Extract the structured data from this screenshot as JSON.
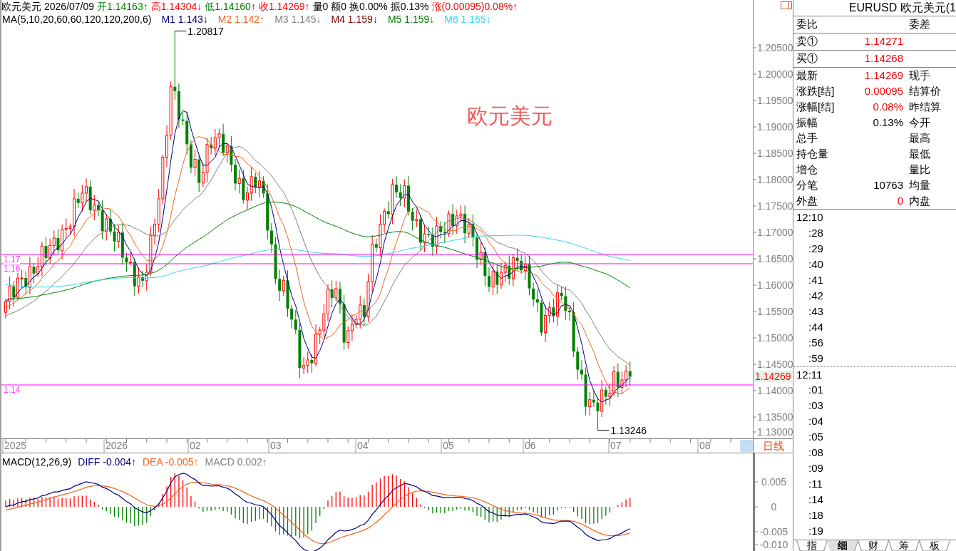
{
  "chart_header": {
    "quote_items": [
      {
        "text": "欧元美元",
        "color": "#000000"
      },
      {
        "text": "2026/07/09",
        "color": "#000000"
      },
      {
        "text": "开1.14163↑",
        "color": "#008000"
      },
      {
        "text": "高1.14304↓",
        "color": "#ff0000"
      },
      {
        "text": "低1.14160↑",
        "color": "#008000"
      },
      {
        "text": "收1.14269↑",
        "color": "#ff0000"
      },
      {
        "text": "量0",
        "color": "#000000"
      },
      {
        "text": "额0",
        "color": "#000000"
      },
      {
        "text": "换0.00%",
        "color": "#000000"
      },
      {
        "text": "振0.13%",
        "color": "#000000"
      },
      {
        "text": "涨(0.00095)0.08%↑",
        "color": "#ff0000"
      }
    ],
    "ma_legend": [
      {
        "text": "MA(5,10,20,60,60,120,120,200,6)",
        "color": "#000000"
      },
      {
        "text": "M1 1.143↓",
        "color": "#000080"
      },
      {
        "text": "M2 1.142↑",
        "color": "#f26522"
      },
      {
        "text": "M3 1.145↓",
        "color": "#808080"
      },
      {
        "text": "M4 1.159↓",
        "color": "#800000"
      },
      {
        "text": "M5 1.159↓",
        "color": "#008000"
      },
      {
        "text": "M6 1.165↓",
        "color": "#33d6f0"
      }
    ]
  },
  "price_chart": {
    "symbol_label": "欧元美元",
    "high_marker": "1.20817",
    "low_marker": "1.13246",
    "drawn_lines": [
      {
        "label": "1.17"
      },
      {
        "label": "1.16"
      },
      {
        "label": "1.14"
      }
    ],
    "price_axis": [
      "1.20500",
      "1.20000",
      "1.19500",
      "1.19000",
      "1.18500",
      "1.18000",
      "1.17500",
      "1.17000",
      "1.16500",
      "1.16000",
      "1.15500",
      "1.15000",
      "1.14500",
      "1.14000",
      "1.13500",
      "1.13000"
    ],
    "current_price": "1.14269",
    "time_axis": [
      "2025",
      "2026",
      "02",
      "03",
      "04",
      "05",
      "06",
      "07",
      "08"
    ],
    "period": "日线"
  },
  "macd": {
    "legend": [
      {
        "text": "MACD(12,26,9)",
        "color": "#000000"
      },
      {
        "text": "DIFF -0.004↑",
        "color": "#000080"
      },
      {
        "text": "DEA -0.005↑",
        "color": "#f26522"
      },
      {
        "text": "MACD 0.002↑",
        "color": "#808080"
      }
    ],
    "axis": [
      "0.005",
      "0",
      "-0.005",
      "-0.010"
    ]
  },
  "quote_panel": {
    "title": "EURUSD 欧元美元(1",
    "order_ratio": {
      "label": "委比",
      "right_label": "委差"
    },
    "order_book": [
      {
        "label": "卖①",
        "price": "1.14271",
        "color": "#ff0000"
      },
      {
        "label": "买①",
        "price": "1.14268",
        "color": "#ff0000"
      }
    ],
    "stats": [
      {
        "label": "最新",
        "value": "1.14269",
        "color": "#ff0000",
        "right_label": "现手"
      },
      {
        "label": "涨跌[结]",
        "value": "0.00095",
        "color": "#ff0000",
        "right_label": "结算价"
      },
      {
        "label": "涨幅[结]",
        "value": "0.08%",
        "color": "#ff0000",
        "right_label": "昨结算"
      },
      {
        "label": "振幅",
        "value": "0.13%",
        "color": "#000000",
        "right_label": "今开"
      },
      {
        "label": "总手",
        "right_label": "最高"
      },
      {
        "label": "持仓量",
        "right_label": "最低"
      },
      {
        "label": "增仓",
        "right_label": "量比"
      },
      {
        "label": "分笔",
        "value": "10763",
        "color": "#000000",
        "right_label": "均量"
      },
      {
        "label": "外盘",
        "value": "0",
        "color": "#ff0000",
        "right_label": "内盘"
      }
    ],
    "ticks": [
      {
        "time": "12:10",
        "kind": "minute"
      },
      {
        "time": ":28",
        "kind": "second"
      },
      {
        "time": ":29",
        "kind": "second"
      },
      {
        "time": ":40",
        "kind": "second"
      },
      {
        "time": ":41",
        "kind": "second"
      },
      {
        "time": ":42",
        "kind": "second"
      },
      {
        "time": ":43",
        "kind": "second"
      },
      {
        "time": ":44",
        "kind": "second"
      },
      {
        "time": ":56",
        "kind": "second"
      },
      {
        "time": ":59",
        "kind": "second"
      },
      {
        "time": "12:11",
        "kind": "minute"
      },
      {
        "time": ":01",
        "kind": "second"
      },
      {
        "time": ":03",
        "kind": "second"
      },
      {
        "time": ":04",
        "kind": "second"
      },
      {
        "time": ":05",
        "kind": "second"
      },
      {
        "time": ":08",
        "kind": "second"
      },
      {
        "time": ":09",
        "kind": "second"
      },
      {
        "time": ":11",
        "kind": "second"
      },
      {
        "time": ":14",
        "kind": "second"
      },
      {
        "time": ":18",
        "kind": "second"
      },
      {
        "time": ":19",
        "kind": "second"
      }
    ],
    "tabs": [
      {
        "label": "指",
        "selected": false
      },
      {
        "label": "细",
        "selected": true
      },
      {
        "label": "财",
        "selected": false
      },
      {
        "label": "筹",
        "selected": false
      },
      {
        "label": "板",
        "selected": false
      }
    ]
  }
}
